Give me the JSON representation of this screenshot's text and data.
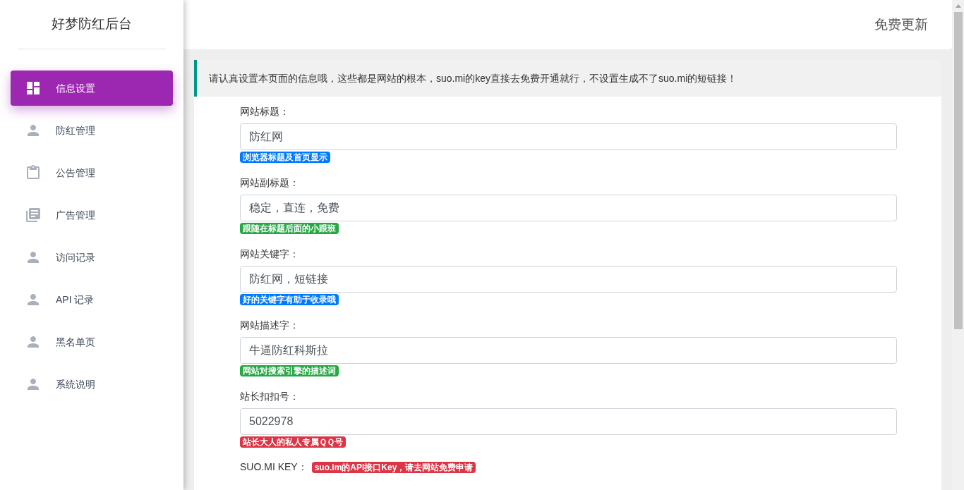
{
  "sidebar": {
    "title": "好梦防红后台",
    "items": [
      {
        "label": "信息设置",
        "kind": "dashboard",
        "selected": true
      },
      {
        "label": "防红管理",
        "kind": "person",
        "selected": false
      },
      {
        "label": "公告管理",
        "kind": "clipboard",
        "selected": false
      },
      {
        "label": "广告管理",
        "kind": "library",
        "selected": false
      },
      {
        "label": "访问记录",
        "kind": "person",
        "selected": false
      },
      {
        "label": "API 记录",
        "kind": "person",
        "selected": false
      },
      {
        "label": "黑名单页",
        "kind": "person",
        "selected": false
      },
      {
        "label": "系统说明",
        "kind": "person",
        "selected": false
      }
    ]
  },
  "header": {
    "link": "免费更新"
  },
  "notice": "请认真设置本页面的信息哦，这些都是网站的根本，suo.mi的key直接去免费开通就行，不设置生成不了suo.mi的短链接！",
  "fields": [
    {
      "kind": "input",
      "label": "网站标题：",
      "value": "防红网",
      "hint": "浏览器标题及首页显示",
      "color": "#007bff"
    },
    {
      "kind": "input",
      "label": "网站副标题：",
      "value": "稳定，直连，免费",
      "hint": "跟随在标题后面的小跟班",
      "color": "#28a745"
    },
    {
      "kind": "input",
      "label": "网站关键字：",
      "value": "防红网，短链接",
      "hint": "好的关键字有助于收录哦",
      "color": "#007bff"
    },
    {
      "kind": "input",
      "label": "网站描述字：",
      "value": "牛逼防红科斯拉",
      "hint": "网站对搜索引擎的描述词",
      "color": "#28a745"
    },
    {
      "kind": "input",
      "label": "站长扣扣号：",
      "value": "5022978",
      "hint": "站长大人的私人专属ＱＱ号",
      "color": "#dc3545"
    },
    {
      "kind": "inline",
      "label": "SUO.MI KEY：",
      "hint": "suo.im的API接口Key，请去网站免费申请",
      "color": "#dc3545"
    }
  ]
}
